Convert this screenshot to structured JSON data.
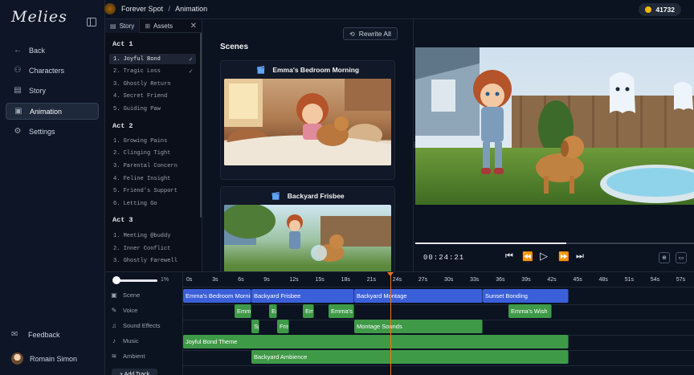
{
  "app": {
    "logo": "Melies"
  },
  "sidebar": {
    "items": [
      {
        "label": "Back",
        "icon": "arrow-left-icon"
      },
      {
        "label": "Characters",
        "icon": "users-icon"
      },
      {
        "label": "Story",
        "icon": "book-icon"
      },
      {
        "label": "Animation",
        "icon": "film-icon",
        "active": true
      },
      {
        "label": "Settings",
        "icon": "gear-icon"
      }
    ],
    "feedback": "Feedback",
    "user": "Romain Simon"
  },
  "topbar": {
    "project": "Forever Spot",
    "separator": "/",
    "page": "Animation",
    "credits": "41732"
  },
  "story_panel": {
    "tabs": [
      "Story",
      "Assets"
    ],
    "acts": [
      {
        "title": "Act 1",
        "items": [
          {
            "label": "1. Joyful Bond",
            "selected": true,
            "done": true
          },
          {
            "label": "2. Tragic Loss",
            "done": true
          },
          {
            "label": "3. Ghostly Return"
          },
          {
            "label": "4. Secret Friend"
          },
          {
            "label": "5. Guiding Paw"
          }
        ]
      },
      {
        "title": "Act 2",
        "items": [
          {
            "label": "1. Growing Pains"
          },
          {
            "label": "2. Clinging Tight"
          },
          {
            "label": "3. Parental Concern"
          },
          {
            "label": "4. Feline Insight"
          },
          {
            "label": "5. Friend's Support"
          },
          {
            "label": "6. Letting Go"
          }
        ]
      },
      {
        "title": "Act 3",
        "items": [
          {
            "label": "1. Meeting @buddy"
          },
          {
            "label": "2. Inner Conflict"
          },
          {
            "label": "3. Ghostly Farewell"
          }
        ]
      }
    ]
  },
  "scenes_panel": {
    "rewrite_label": "Rewrite All",
    "title": "Scenes",
    "cards": [
      {
        "title": "Emma's Bedroom Morning"
      },
      {
        "title": "Backyard Frisbee"
      }
    ]
  },
  "preview": {
    "timecode": "00:24:21",
    "progress": 0.54
  },
  "timeline": {
    "zoom_percent": "1%",
    "ticks": [
      "0s",
      "3s",
      "6s",
      "9s",
      "12s",
      "15s",
      "18s",
      "21s",
      "24s",
      "27s",
      "30s",
      "33s",
      "36s",
      "39s",
      "42s",
      "45s",
      "48s",
      "51s",
      "54s",
      "57s"
    ],
    "tracks": [
      {
        "label": "Scene",
        "icon": "film-icon"
      },
      {
        "label": "Voice",
        "icon": "mic-icon"
      },
      {
        "label": "Sound Effects",
        "icon": "bell-icon"
      },
      {
        "label": "Music",
        "icon": "music-icon"
      },
      {
        "label": "Ambient",
        "icon": "wave-icon"
      }
    ],
    "clips": {
      "scene": [
        "Emma's Bedroom Morning",
        "Backyard Frisbee",
        "Backyard Montage",
        "Sunset Bonding"
      ],
      "voice": [
        "Emma",
        "Er",
        "Em",
        "Emma's",
        "Emma's Wish"
      ],
      "sfx": [
        "Sp",
        "Fris",
        "Montage Sounds"
      ],
      "music": [
        "Joyful Bond Theme"
      ],
      "ambient": [
        "Backyard Ambience"
      ]
    },
    "add_track": "+ Add Track"
  },
  "colors": {
    "scene_clip": "#3b5fd9",
    "audio_clip": "#3f9a48",
    "playhead": "#f97316",
    "coin": "#f5b800"
  }
}
